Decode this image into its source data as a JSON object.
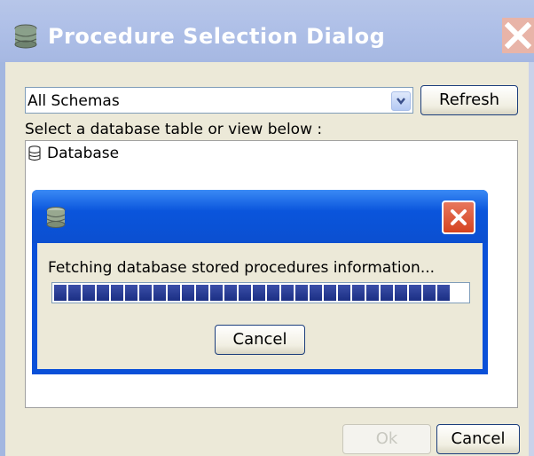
{
  "window": {
    "title": "Procedure Selection Dialog",
    "icon": "database-icon",
    "close_icon": "close-icon"
  },
  "schema": {
    "selected": "All Schemas",
    "dropdown_icon": "chevron-down-icon"
  },
  "toolbar": {
    "refresh_label": "Refresh"
  },
  "instruction": "Select a database table or view below :",
  "tree": {
    "items": [
      {
        "label": "Database",
        "icon": "database-icon"
      }
    ]
  },
  "progress_dialog": {
    "icon": "database-icon",
    "message": "Fetching database stored procedures information...",
    "progress_segments": 28,
    "cancel_label": "Cancel"
  },
  "footer": {
    "ok_label": "Ok",
    "ok_enabled": false,
    "cancel_label": "Cancel"
  },
  "colors": {
    "title_bar": "#aebfe7",
    "inner_title_bar": "#0a55dc",
    "progress_fill": "#1b2f84",
    "dialog_bg": "#ece9d8"
  }
}
